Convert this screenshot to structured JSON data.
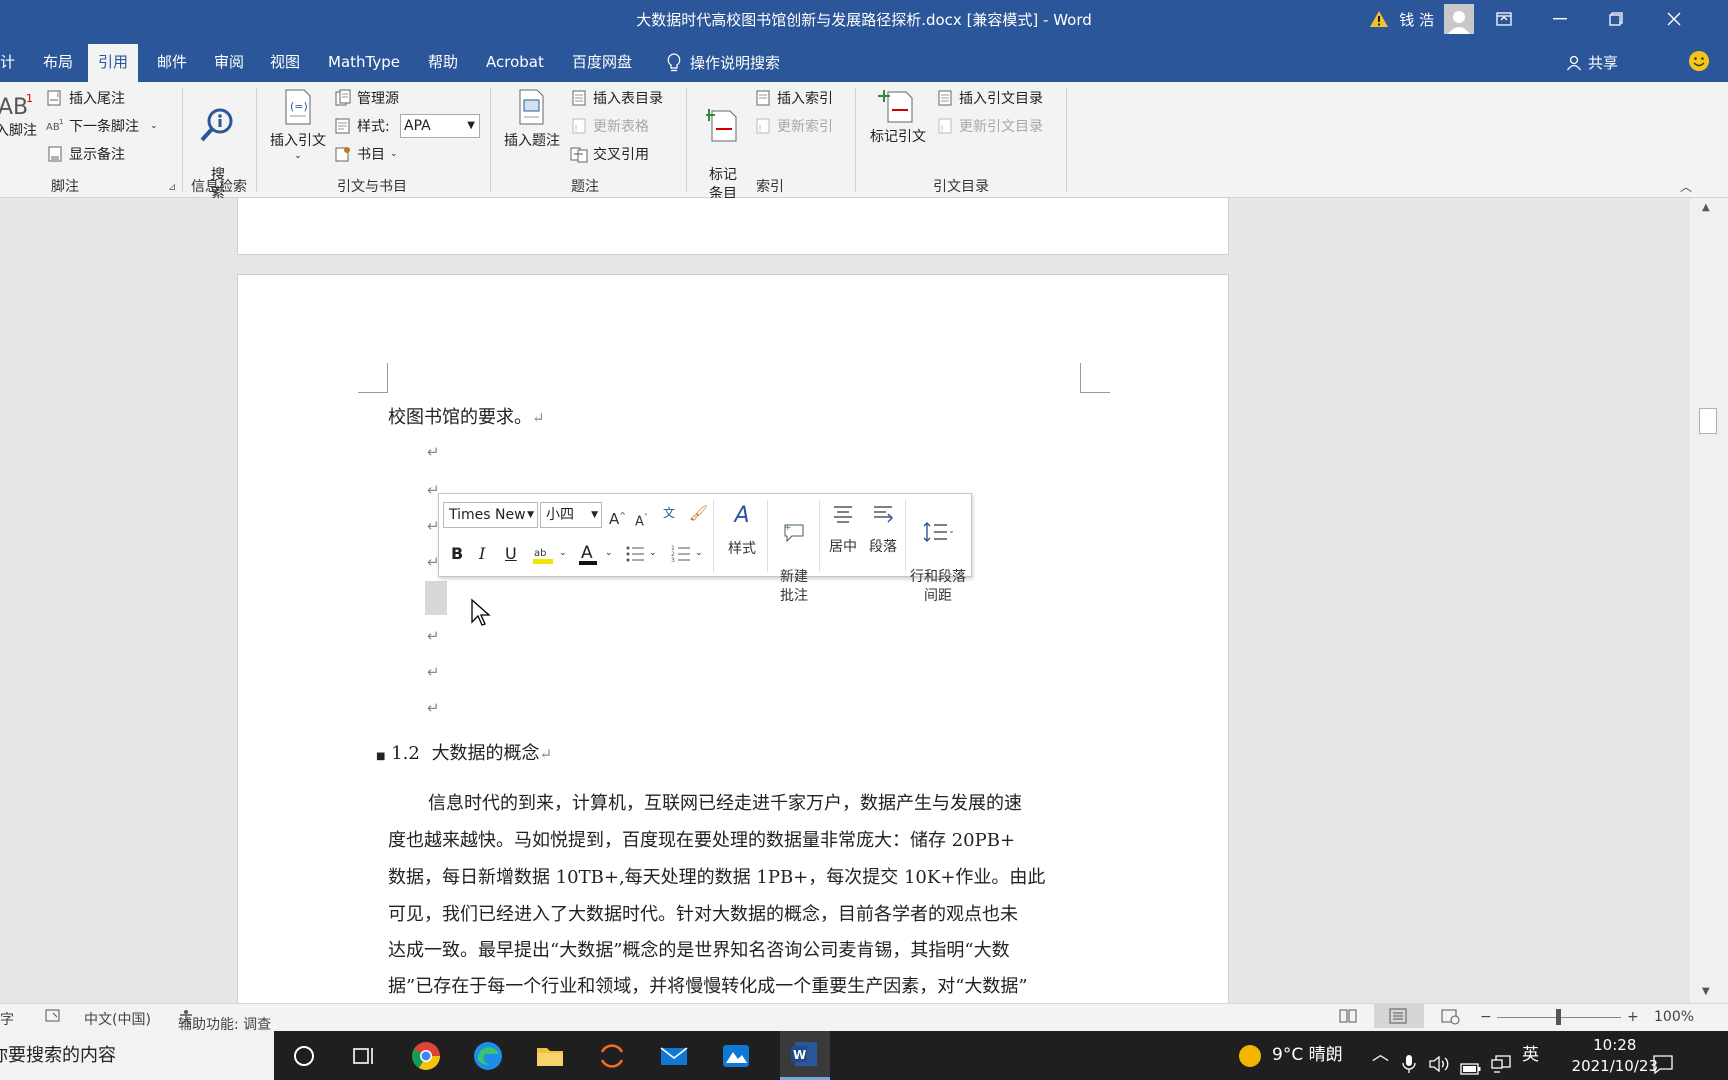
{
  "window": {
    "title": "大数据时代高校图书馆创新与发展路径探析.docx [兼容模式]  -  Word",
    "user_name": "钱 浩"
  },
  "tabs": [
    {
      "label": "计"
    },
    {
      "label": "布局"
    },
    {
      "label": "引用"
    },
    {
      "label": "邮件"
    },
    {
      "label": "审阅"
    },
    {
      "label": "视图"
    },
    {
      "label": "MathType"
    },
    {
      "label": "帮助"
    },
    {
      "label": "Acrobat"
    },
    {
      "label": "百度网盘"
    },
    {
      "label": "操作说明搜索"
    }
  ],
  "share_label": "共享",
  "ribbon": {
    "footnote": {
      "insert_footnote": "入脚注",
      "insert_endnote": "插入尾注",
      "next_footnote": "下一条脚注",
      "show_notes": "显示备注",
      "group": "脚注"
    },
    "research": {
      "search": "搜\n索",
      "group": "信息检索"
    },
    "citations": {
      "insert_citation": "插入引文",
      "manage_sources": "管理源",
      "style_label": "样式:",
      "style_value": "APA",
      "bibliography": "书目",
      "group": "引文与书目"
    },
    "captions": {
      "insert_caption": "插入题注",
      "insert_table_of_figures": "插入表目录",
      "update_table": "更新表格",
      "cross_reference": "交叉引用",
      "group": "题注"
    },
    "index": {
      "mark_entry": "标记\n条目",
      "insert_index": "插入索引",
      "update_index": "更新索引",
      "group": "索引"
    },
    "toa": {
      "mark_citation": "标记引文",
      "insert_toa": "插入引文目录",
      "update_toa": "更新引文目录",
      "group": "引文目录"
    }
  },
  "doc": {
    "line_top": "校图书馆的要求。",
    "heading_num": "1.2",
    "heading_text": "大数据的概念",
    "body_lines": [
      "信息时代的到来，计算机，互联网已经走进千家万户，数据产生与发展的速",
      "度也越来越快。马如悦提到，百度现在要处理的数据量非常庞大：储存 20PB+",
      "数据，每日新增数据 10TB+,每天处理的数据 1PB+，每次提交 10K+作业。由此",
      "可见，我们已经进入了大数据时代。针对大数据的概念，目前各学者的观点也未",
      "达成一致。最早提出“大数据”概念的是世界知名咨询公司麦肯锡，其指明“大数",
      "据”已存在于每一个行业和领域，并将慢慢转化成一个重要生产因素，对“大数据”"
    ]
  },
  "mini_toolbar": {
    "font": "Times New",
    "size": "小四",
    "bold": "B",
    "italic": "I",
    "underline": "U",
    "styles": "样式",
    "new_comment": "新建\n批注",
    "center": "居中",
    "paragraph": "段落",
    "line_spacing": "行和段落\n间距"
  },
  "status": {
    "word_count": "字",
    "language": "中文(中国)",
    "accessibility": "辅助功能: 调查",
    "zoom": "100%"
  },
  "taskbar": {
    "search_placeholder": "你要搜索的内容",
    "weather": "9°C  晴朗",
    "ime": "英",
    "time": "10:28",
    "date": "2021/10/23"
  }
}
